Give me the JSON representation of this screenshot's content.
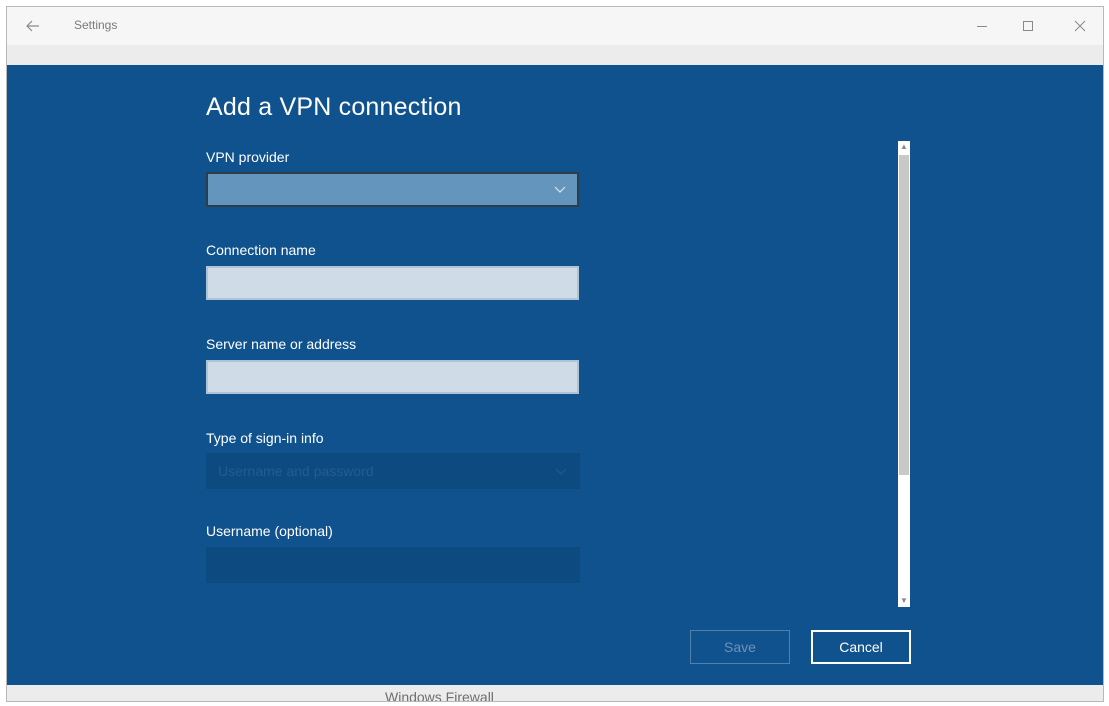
{
  "window": {
    "title": "Settings"
  },
  "background": {
    "footer_item": "Windows Firewall"
  },
  "dialog": {
    "title": "Add a VPN connection",
    "vpn_provider": {
      "label": "VPN provider",
      "value": ""
    },
    "connection_name": {
      "label": "Connection name",
      "value": ""
    },
    "server": {
      "label": "Server name or address",
      "value": ""
    },
    "sign_in_type": {
      "label": "Type of sign-in info",
      "value": "Username and password"
    },
    "username": {
      "label": "Username (optional)",
      "value": ""
    },
    "save_label": "Save",
    "cancel_label": "Cancel"
  },
  "colors": {
    "dialog_bg": "#0f528e",
    "titlebar_bg": "#f6f6f6"
  },
  "icons": {
    "back": "back-arrow-icon",
    "minimize": "minimize-icon",
    "maximize": "maximize-icon",
    "close": "close-icon",
    "dropdown": "chevron-down-icon"
  }
}
